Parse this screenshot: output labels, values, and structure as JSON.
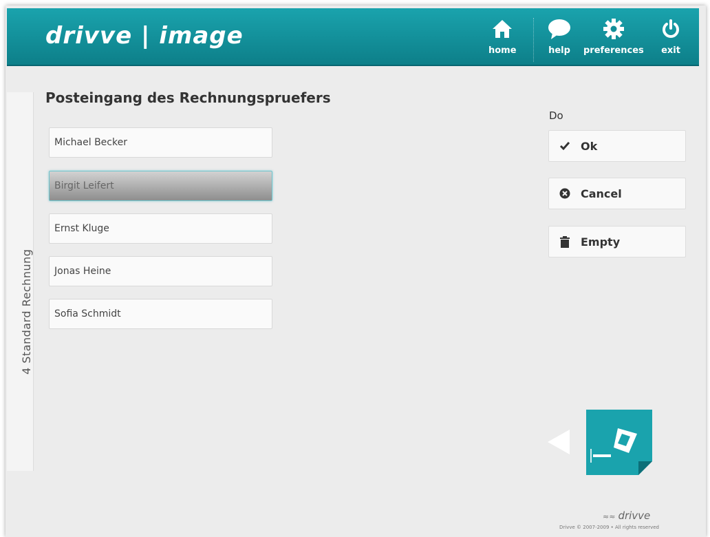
{
  "header": {
    "logo": "drivve | image",
    "nav": [
      {
        "label": "home",
        "icon": "home-icon"
      },
      {
        "label": "help",
        "icon": "speech-bubble-icon"
      },
      {
        "label": "preferences",
        "icon": "gear-icon"
      },
      {
        "label": "exit",
        "icon": "power-icon"
      }
    ]
  },
  "sidebar": {
    "tab_label": "4 Standard Rechnung"
  },
  "main": {
    "title": "Posteingang des Rechnungspruefers",
    "recipients": [
      {
        "name": "Michael Becker",
        "selected": false
      },
      {
        "name": "Birgit Leifert",
        "selected": true
      },
      {
        "name": "Ernst Kluge",
        "selected": false
      },
      {
        "name": "Jonas Heine",
        "selected": false
      },
      {
        "name": "Sofia Schmidt",
        "selected": false
      }
    ]
  },
  "actions": {
    "heading": "Do",
    "buttons": [
      {
        "label": "Ok",
        "icon": "checkmark-icon"
      },
      {
        "label": "Cancel",
        "icon": "cancel-circle-icon"
      },
      {
        "label": "Empty",
        "icon": "trash-icon"
      }
    ]
  },
  "footer": {
    "logo": "drivve",
    "copyright": "Drivve © 2007-2009 • All rights reserved"
  },
  "colors": {
    "header_top": "#1aa3ad",
    "header_bottom": "#0d7f89",
    "accent": "#17a2ac"
  }
}
